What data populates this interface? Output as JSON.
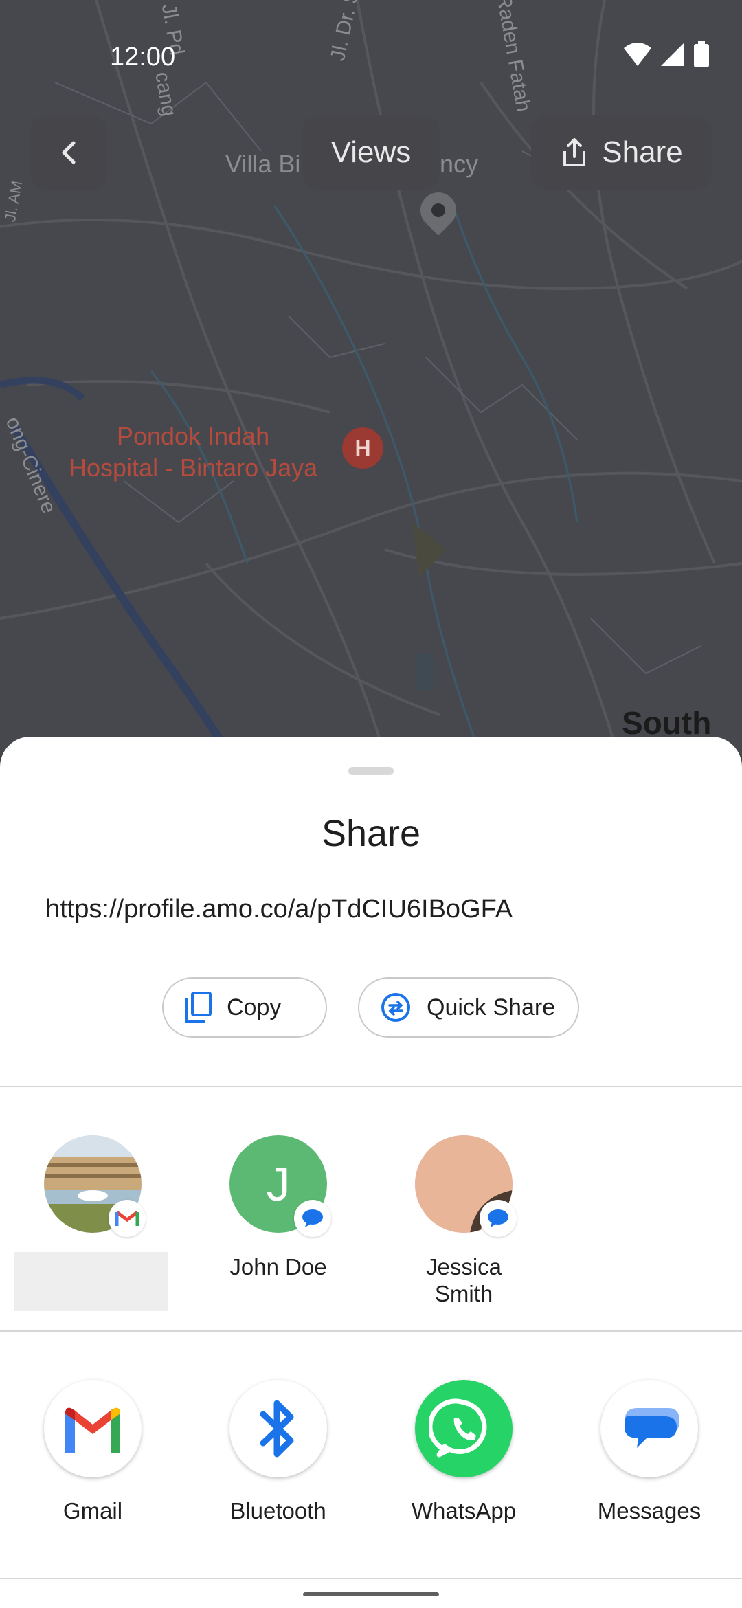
{
  "status_bar": {
    "time": "12:00"
  },
  "map": {
    "labels": {
      "villa": "Villa Bi",
      "villa_suffix": "ncy",
      "pd": "Jl. Pd.",
      "cang": "cang",
      "jl_dr": "Jl. Dr. S",
      "raden": "Raden Fatah",
      "jl_am": "Jl. AM",
      "cinere": "ong-Cinere",
      "south": "South"
    },
    "hospital": {
      "name_line1": "Pondok Indah",
      "name_line2": "Hospital - Bintaro Jaya",
      "icon_letter": "H"
    }
  },
  "toolbar": {
    "views_label": "Views",
    "share_label": "Share"
  },
  "sheet": {
    "title": "Share",
    "url": "https://profile.amo.co/a/pTdCIU6IBoGFA",
    "copy_label": "Copy",
    "quick_share_label": "Quick Share"
  },
  "direct_share": [
    {
      "name": "",
      "app": "gmail"
    },
    {
      "name": "John Doe",
      "initial": "J",
      "app": "messages"
    },
    {
      "name_line1": "Jessica",
      "name_line2": "Smith",
      "app": "messages"
    }
  ],
  "apps": [
    {
      "label": "Gmail"
    },
    {
      "label": "Bluetooth"
    },
    {
      "label": "WhatsApp"
    },
    {
      "label": "Messages"
    }
  ],
  "colors": {
    "john_avatar": "#5bb974",
    "whatsapp": "#25d366",
    "bluetooth": "#1a73e8",
    "messages": "#1a73e8"
  }
}
